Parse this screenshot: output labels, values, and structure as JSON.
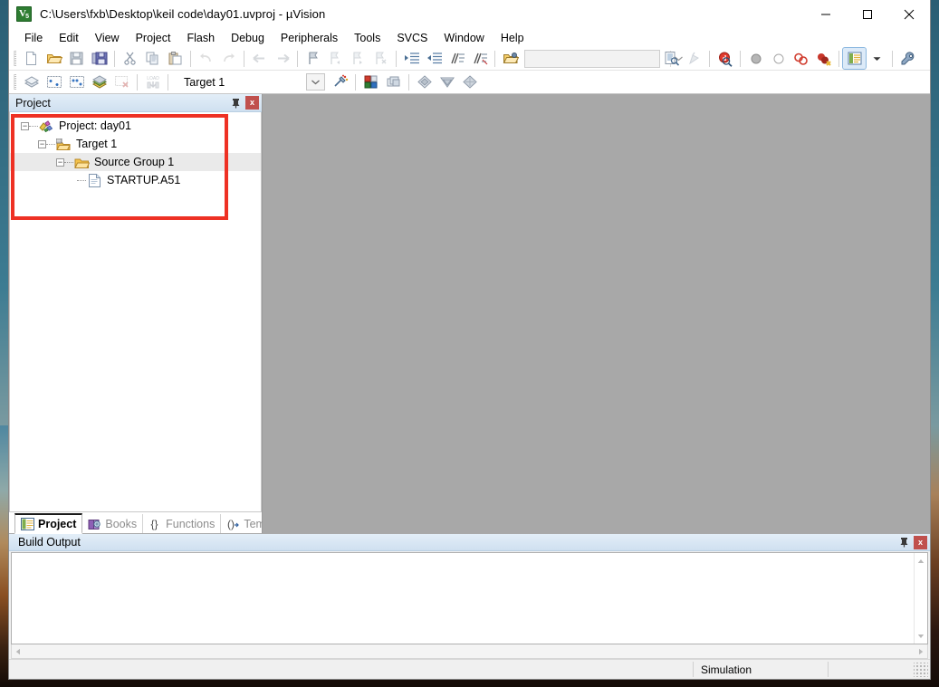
{
  "window": {
    "title": "C:\\Users\\fxb\\Desktop\\keil code\\day01.uvproj - µVision",
    "app_icon": "uvision-icon",
    "minimize": "–",
    "maximize": "□",
    "close": "✕"
  },
  "menubar": {
    "items": [
      {
        "label": "File"
      },
      {
        "label": "Edit"
      },
      {
        "label": "View"
      },
      {
        "label": "Project"
      },
      {
        "label": "Flash"
      },
      {
        "label": "Debug"
      },
      {
        "label": "Peripherals"
      },
      {
        "label": "Tools"
      },
      {
        "label": "SVCS"
      },
      {
        "label": "Window"
      },
      {
        "label": "Help"
      }
    ]
  },
  "toolbar_file": {
    "buttons": [
      {
        "name": "new-file-icon",
        "tip": "New"
      },
      {
        "name": "open-file-icon",
        "tip": "Open"
      },
      {
        "name": "save-icon",
        "tip": "Save"
      },
      {
        "name": "save-all-icon",
        "tip": "Save All"
      },
      {
        "name": "cut-icon",
        "tip": "Cut"
      },
      {
        "name": "copy-icon",
        "tip": "Copy"
      },
      {
        "name": "paste-icon",
        "tip": "Paste"
      },
      {
        "name": "undo-icon",
        "tip": "Undo"
      },
      {
        "name": "redo-icon",
        "tip": "Redo"
      },
      {
        "name": "navigate-back-icon",
        "tip": "Back"
      },
      {
        "name": "navigate-forward-icon",
        "tip": "Forward"
      },
      {
        "name": "bookmark-toggle-icon",
        "tip": "Insert/Remove Bookmark"
      },
      {
        "name": "bookmark-prev-icon",
        "tip": "Previous Bookmark"
      },
      {
        "name": "bookmark-next-icon",
        "tip": "Next Bookmark"
      },
      {
        "name": "bookmark-clear-icon",
        "tip": "Clear All Bookmarks"
      },
      {
        "name": "indent-icon",
        "tip": "Indent Selected Text"
      },
      {
        "name": "outdent-icon",
        "tip": "Outdent Selected Text"
      },
      {
        "name": "comment-icon",
        "tip": "Comment Selection"
      },
      {
        "name": "uncomment-icon",
        "tip": "Uncomment Selection"
      },
      {
        "name": "open-project-icon",
        "tip": "Open Project"
      }
    ],
    "search_placeholder": "",
    "search_value": "",
    "after_search": [
      {
        "name": "find-in-files-icon",
        "tip": "Find in Files"
      },
      {
        "name": "bookmark-tool-icon",
        "tip": "Bookmarks"
      },
      {
        "name": "debug-query-icon",
        "tip": "Start/Stop Debug Session"
      },
      {
        "name": "breakpoint-icon",
        "tip": "Insert/Remove Breakpoint"
      },
      {
        "name": "breakpoint-disable-icon",
        "tip": "Enable/Disable Breakpoint"
      },
      {
        "name": "breakpoint-disable-all-icon",
        "tip": "Disable All Breakpoints"
      },
      {
        "name": "breakpoint-kill-all-icon",
        "tip": "Kill All Breakpoints"
      },
      {
        "name": "window-layout-icon",
        "tip": "Manage Window Layout"
      },
      {
        "name": "layout-dropdown-icon",
        "tip": "Layout options"
      },
      {
        "name": "configure-icon",
        "tip": "Configuration Wizard"
      }
    ]
  },
  "toolbar_build": {
    "buttons": [
      {
        "name": "translate-icon",
        "tip": "Translate Current File"
      },
      {
        "name": "build-icon",
        "tip": "Build"
      },
      {
        "name": "rebuild-icon",
        "tip": "Rebuild All Target Files"
      },
      {
        "name": "batch-build-icon",
        "tip": "Batch Build"
      },
      {
        "name": "stop-build-icon",
        "tip": "Stop Build"
      },
      {
        "name": "download-icon",
        "tip": "Download"
      }
    ],
    "target_value": "Target 1",
    "after_target": [
      {
        "name": "target-options-icon",
        "tip": "Options for Target"
      },
      {
        "name": "manage-project-items-icon",
        "tip": "Manage Project Items"
      },
      {
        "name": "multi-project-icon",
        "tip": "Manage Multi-Project Workspace"
      },
      {
        "name": "pack-installer-icon",
        "tip": "Pack Installer"
      },
      {
        "name": "select-software-packs-icon",
        "tip": "Select Software Packs"
      },
      {
        "name": "manage-run-time-icon",
        "tip": "Manage Run-Time Environment"
      }
    ]
  },
  "project_panel": {
    "title": "Project",
    "pin_label": "丬",
    "close_label": "x",
    "tree": [
      {
        "label": "Project: day01",
        "icon": "project-icon",
        "depth": 0,
        "expander": "−",
        "highlight": false
      },
      {
        "label": "Target 1",
        "icon": "target-icon",
        "depth": 1,
        "expander": "−",
        "highlight": false
      },
      {
        "label": "Source Group 1",
        "icon": "folder-open-icon",
        "depth": 2,
        "expander": "−",
        "highlight": true
      },
      {
        "label": "STARTUP.A51",
        "icon": "file-asm-icon",
        "depth": 3,
        "expander": "",
        "highlight": false
      }
    ],
    "annotation_color": "#ee3124"
  },
  "bottom_tabs": [
    {
      "label": "Project",
      "icon": "project-tab-icon",
      "active": true
    },
    {
      "label": "Books",
      "icon": "books-tab-icon",
      "active": false
    },
    {
      "label": "Functions",
      "icon": "functions-tab-icon",
      "active": false
    },
    {
      "label": "Templates",
      "icon": "templates-tab-icon",
      "active": false
    }
  ],
  "build_output": {
    "title": "Build Output",
    "pin_label": "丬",
    "close_label": "x",
    "content": "",
    "scroll_up": "▲",
    "scroll_down": "▼",
    "scroll_left": "◀",
    "scroll_right": "▶"
  },
  "statusbar": {
    "left": "",
    "mode": "Simulation",
    "right": ""
  }
}
